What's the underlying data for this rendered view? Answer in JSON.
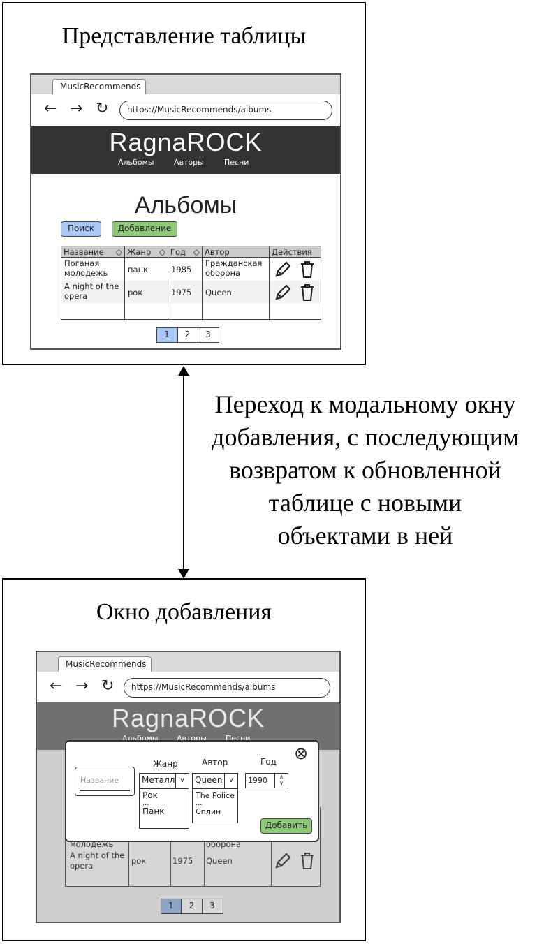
{
  "top_frame": {
    "title": "Представление таблицы",
    "browser": {
      "tab_title": "MusicRecommends",
      "url": "https://MusicRecommends/albums",
      "back_icon": "←",
      "forward_icon": "→",
      "reload_icon": "↻"
    },
    "site": {
      "logo": "RagnaROCK",
      "menu": [
        "Альбомы",
        "Авторы",
        "Песни"
      ],
      "header_color": "#333333"
    },
    "page_heading": "Альбомы",
    "buttons": {
      "search": "Поиск",
      "add": "Добавление",
      "search_color": "#a9c8f5",
      "add_color": "#8fc97a"
    },
    "table": {
      "headers": [
        "Название",
        "Жанр",
        "Год",
        "Автор",
        "Действия"
      ],
      "sort_icon": "◇",
      "rows": [
        {
          "name": "Поганая молодежь",
          "genre": "панк",
          "year": "1985",
          "author": "Гражданская оборона"
        },
        {
          "name": "A night of the opera",
          "genre": "рок",
          "year": "1975",
          "author": "Queen"
        }
      ]
    },
    "pagination": [
      "1",
      "2",
      "3"
    ],
    "active_page_color": "#a9c8f5"
  },
  "caption": "Переход к модальному окну добавления, с последующим возвратом к обновленной таблице с новыми объектами в ней",
  "bottom_frame": {
    "title": "Окно добавления",
    "browser": {
      "tab_title": "MusicRecommends",
      "url": "https://MusicRecommends/albums"
    },
    "site": {
      "logo": "RagnaROCK",
      "menu": [
        "Альбомы",
        "Авторы",
        "Песни"
      ]
    },
    "modal": {
      "name_placeholder": "Название",
      "genre_label": "Жанр",
      "author_label": "Автор",
      "year_label": "Год",
      "genre_selected": "Металл",
      "genre_options": [
        "Рок",
        "...",
        "Панк"
      ],
      "author_selected": "Queen",
      "author_options": [
        "The Police",
        "...",
        "Сплин"
      ],
      "year_value": "1990",
      "add_button": "Добавить",
      "close_icon": "⊗"
    },
    "table_visible": {
      "partial_name": "молодежь",
      "partial_author": "оборона",
      "row2": {
        "name": "A night of the opera",
        "genre": "рок",
        "year": "1975",
        "author": "Queen"
      }
    },
    "pagination": [
      "1",
      "2",
      "3"
    ]
  }
}
